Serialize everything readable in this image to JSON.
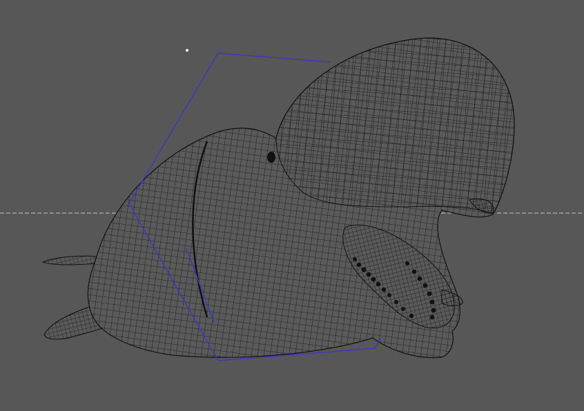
{
  "viewport": {
    "background_color": "#575757",
    "mesh_color": "#111111",
    "mesh_fill": "#5a5a5a",
    "selection_outline_color": "#3a35c8",
    "ground_line_color": "#c8c8c8"
  },
  "scene": {
    "object": "beluga-whale-wireframe-mesh",
    "icons": {
      "light": "light-point-icon"
    }
  }
}
